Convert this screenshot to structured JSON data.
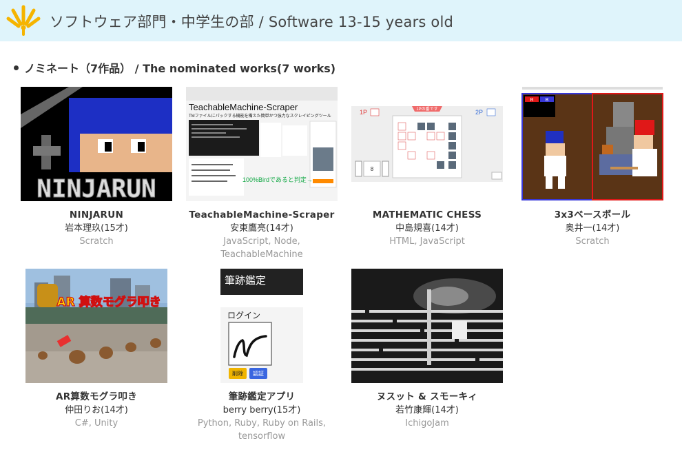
{
  "header": {
    "title": "ソフトウェア部門・中学生の部 / Software 13-15 years old",
    "accent": "#f5b400",
    "background": "#dff4fb"
  },
  "section": {
    "title": "ノミネート（7作品） / The nominated works(7 works)"
  },
  "works": [
    {
      "title": "NINJARUN",
      "author": "岩本理玖(15才)",
      "tags": "Scratch",
      "thumb_text": "NINJARUN"
    },
    {
      "title": "TeachableMachine-Scraper",
      "author": "安東鷹亮(14才)",
      "tags": "JavaScript, Node, TeachableMachine",
      "thumb_text": "TeachableMachine-Scraper",
      "thumb_subtext": "TMファイルにパックする機能を備えた簡単かつ強力なスクレイピングツール",
      "thumb_caption": "100%Birdであると判定→"
    },
    {
      "title": "MATHEMATIC CHESS",
      "author": "中島規喜(14才)",
      "tags": "HTML, JavaScript",
      "thumb_p1": "1P",
      "thumb_p2": "2P",
      "thumb_banner": "1Pの番です",
      "thumb_input": "8"
    },
    {
      "title": "3x3ベースボール",
      "author": "奥井一(14才)",
      "tags": "Scratch",
      "thumb_r": "R",
      "thumb_b": "B"
    },
    {
      "title": "AR算数モグラ叩き",
      "author": "仲田りお(14才)",
      "tags": "C#, Unity",
      "thumb_text": "AR 算数モグラ叩き"
    },
    {
      "title": "筆跡鑑定アプリ",
      "author": "berry berry(15才)",
      "tags": "Python, Ruby, Ruby on Rails, tensorflow",
      "thumb_heading": "筆跡鑑定",
      "thumb_login": "ログイン",
      "thumb_btn1": "削除",
      "thumb_btn2": "認証"
    },
    {
      "title": "ヌスット & スモーキィ",
      "author": "若竹康輝(14才)",
      "tags": "IchigoJam"
    }
  ]
}
